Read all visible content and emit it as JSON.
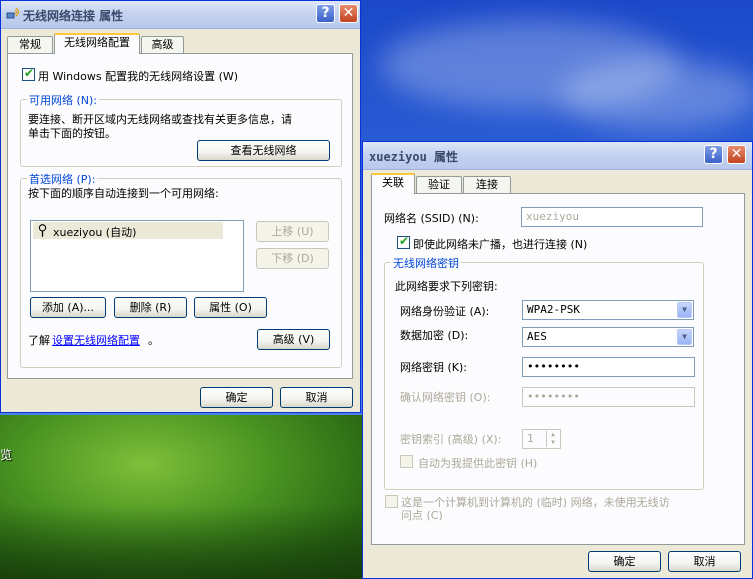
{
  "desktop": {
    "edge_char": "览"
  },
  "main_window": {
    "title": "无线网络连接 属性",
    "help_glyph": "?",
    "close_glyph": "✕",
    "tabs": [
      "常规",
      "无线网络配置",
      "高级"
    ],
    "use_windows_checkbox": {
      "label": "用 Windows 配置我的无线网络设置 (W)",
      "checked": true
    },
    "available": {
      "legend": "可用网络 (N):",
      "desc_line1": "要连接、断开区域内无线网络或查找有关更多信息，请",
      "desc_line2": "单击下面的按钮。",
      "view_button": "查看无线网络"
    },
    "preferred": {
      "legend": "首选网络 (P):",
      "desc": "按下面的顺序自动连接到一个可用网络:",
      "networks": [
        "xueziyou (自动)"
      ],
      "move_up": "上移 (U)",
      "move_down": "下移 (D)",
      "add_button": "添加 (A)...",
      "remove_button": "删除 (R)",
      "properties_button": "属性 (O)",
      "learn_prefix": "了解",
      "learn_link": "设置无线网络配置",
      "learn_suffix": "。",
      "advanced_button": "高级 (V)"
    },
    "ok": "确定",
    "cancel": "取消"
  },
  "props_window": {
    "title": "xueziyou 属性",
    "help_glyph": "?",
    "close_glyph": "✕",
    "tabs": [
      "关联",
      "验证",
      "连接"
    ],
    "ssid_label": "网络名 (SSID) (N):",
    "ssid_value": "xueziyou",
    "connect_even_hidden": {
      "label": "即使此网络未广播，也进行连接 (N)",
      "checked": true
    },
    "key_group": {
      "legend": "无线网络密钥",
      "requires_text": "此网络要求下列密钥:",
      "auth_label": "网络身份验证 (A):",
      "auth_value": "WPA2-PSK",
      "encrypt_label": "数据加密 (D):",
      "encrypt_value": "AES",
      "key_label": "网络密钥 (K):",
      "key_value": "••••••••",
      "confirm_label": "确认网络密钥 (O):",
      "confirm_value": "••••••••",
      "key_index_label": "密钥索引 (高级) (X):",
      "key_index_value": "1",
      "auto_key": {
        "label": "自动为我提供此密钥 (H)",
        "checked": false
      }
    },
    "adhoc": {
      "line1": "这是一个计算机到计算机的 (临时) 网络，未使用无线访",
      "line2": "问点 (C)",
      "checked": false
    },
    "ok": "确定",
    "cancel": "取消"
  }
}
